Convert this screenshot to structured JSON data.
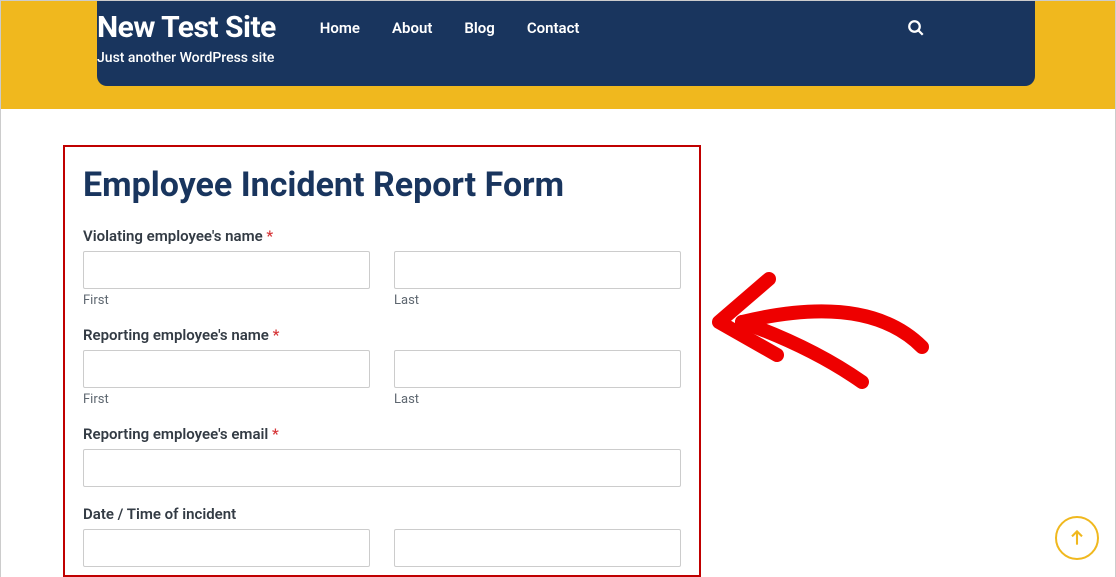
{
  "header": {
    "site_title": "New Test Site",
    "tagline": "Just another WordPress site",
    "nav": {
      "home": "Home",
      "about": "About",
      "blog": "Blog",
      "contact": "Contact"
    }
  },
  "form": {
    "title": "Employee Incident Report Form",
    "fields": {
      "violating_name": {
        "label": "Violating employee's name",
        "required": "*",
        "first_sublabel": "First",
        "last_sublabel": "Last"
      },
      "reporting_name": {
        "label": "Reporting employee's name",
        "required": "*",
        "first_sublabel": "First",
        "last_sublabel": "Last"
      },
      "reporting_email": {
        "label": "Reporting employee's email",
        "required": "*"
      },
      "datetime": {
        "label": "Date / Time of incident"
      }
    }
  }
}
